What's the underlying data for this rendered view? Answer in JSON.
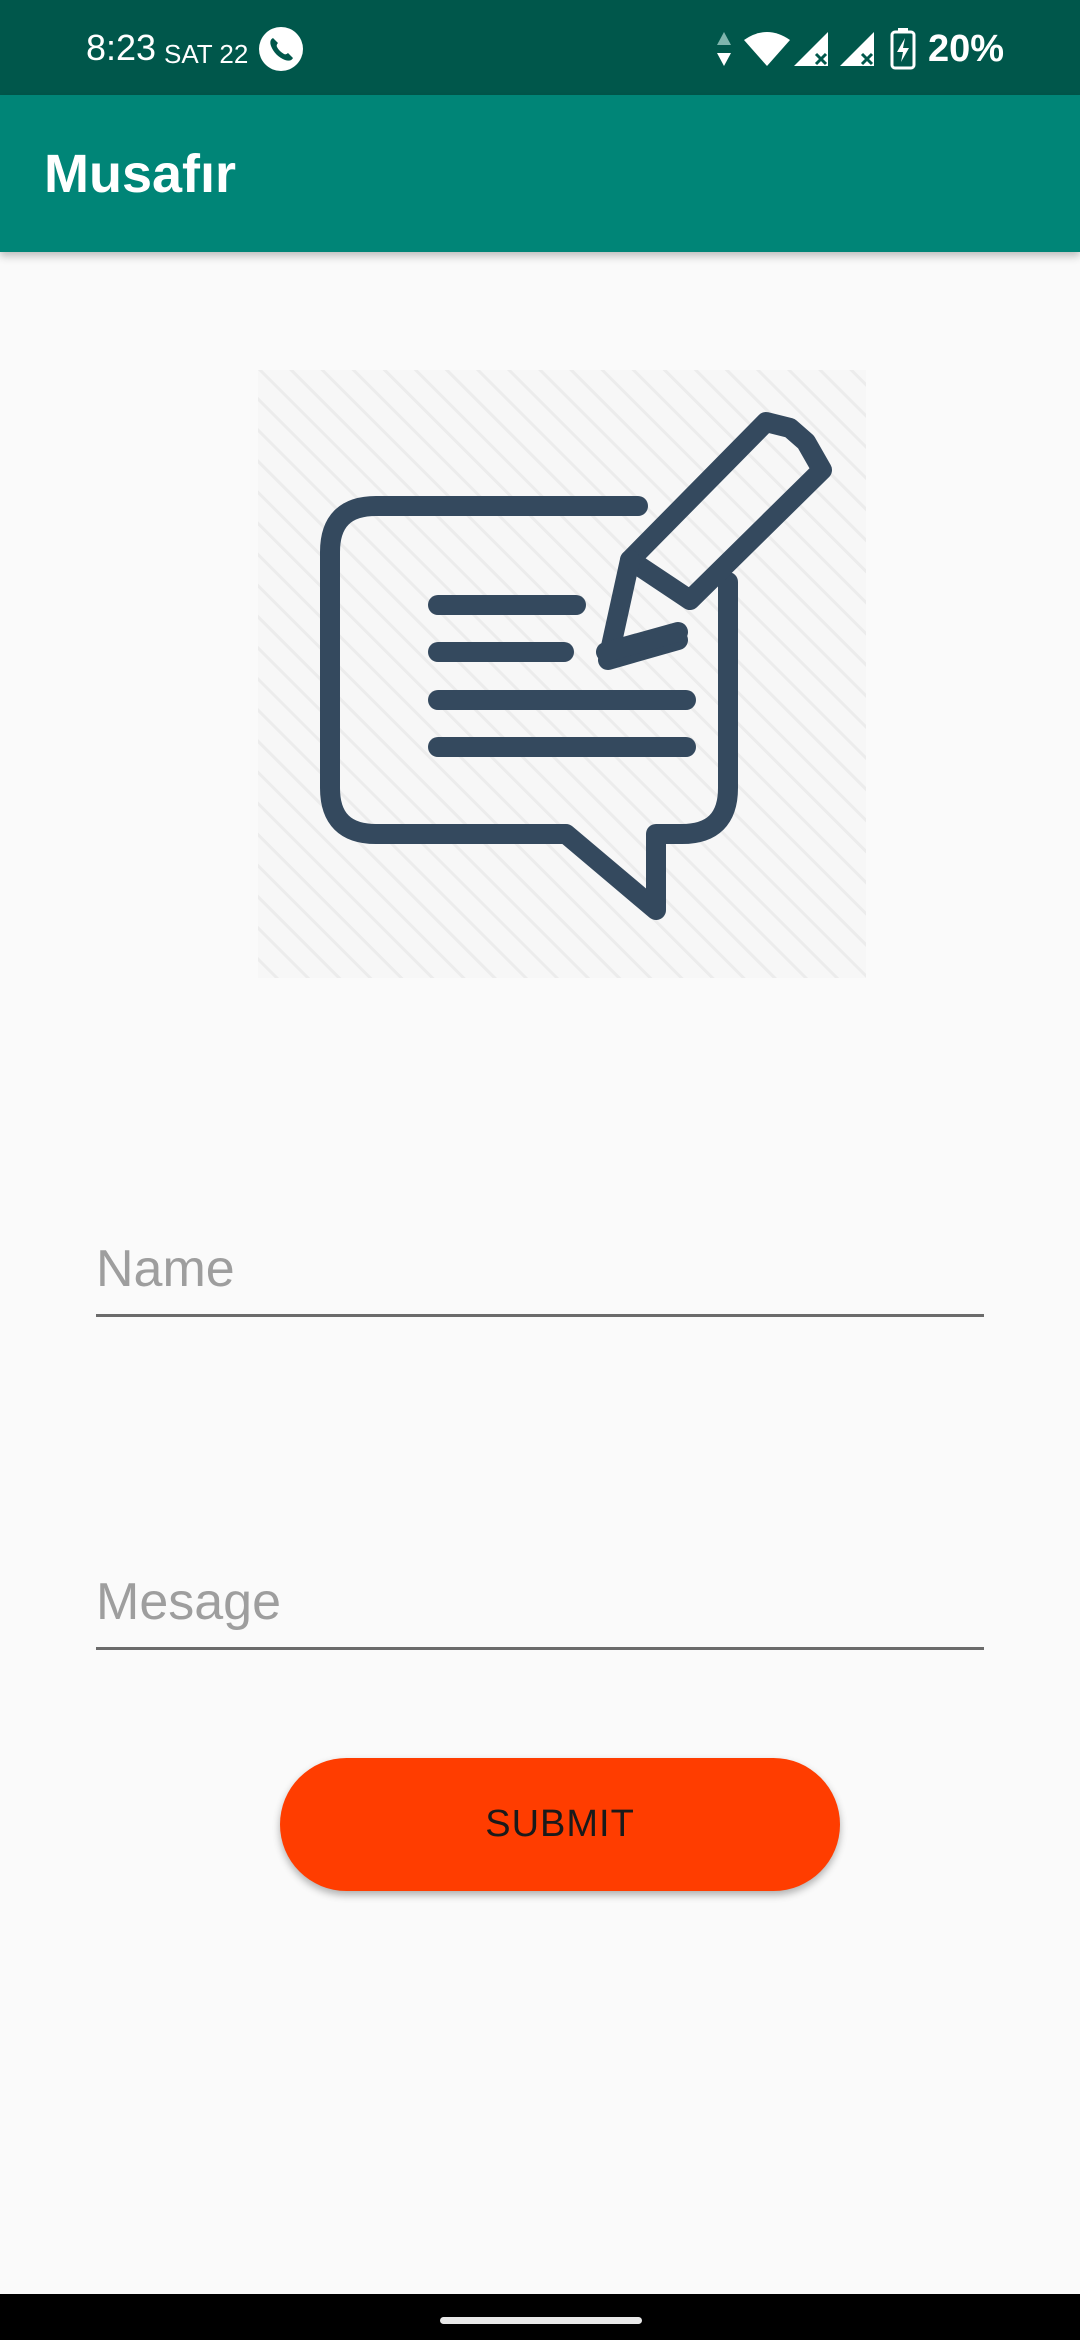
{
  "status_bar": {
    "time": "8:23",
    "date": "SAT 22",
    "battery": "20%",
    "icons": [
      "phone-icon",
      "data-arrows-icon",
      "wifi-icon",
      "signal-icon",
      "signal-icon",
      "battery-charging-icon"
    ]
  },
  "app_bar": {
    "title": "Musafır"
  },
  "hero": {
    "icon": "message-edit-icon"
  },
  "form": {
    "name_placeholder": "Name",
    "message_placeholder": "Mesage",
    "submit_label": "SUBMIT"
  },
  "colors": {
    "status_bar": "#00574b",
    "app_bar": "#008577",
    "accent_button": "#ff3d00",
    "icon_stroke": "#34495e"
  }
}
